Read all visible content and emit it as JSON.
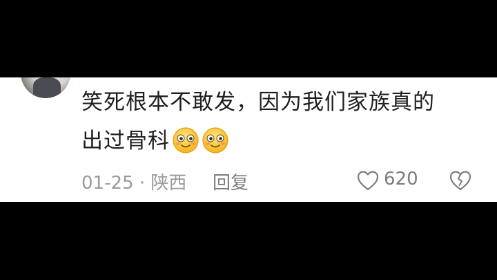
{
  "comment": {
    "line1": "笑死根本不敢发，因为我们家族真的",
    "line2": "出过骨科",
    "emojis": [
      "smiling-blush-emoji",
      "smiling-blush-emoji"
    ]
  },
  "meta": {
    "date_location": "01-25 · 陕西",
    "reply_label": "回复",
    "like_count": "620"
  },
  "colors": {
    "background_bars": "#000000",
    "panel": "#ffffff",
    "text": "#1f1f1f",
    "meta_text": "#9a9a9a"
  },
  "icons": {
    "like": "heart-outline-icon",
    "dislike": "broken-heart-outline-icon"
  }
}
